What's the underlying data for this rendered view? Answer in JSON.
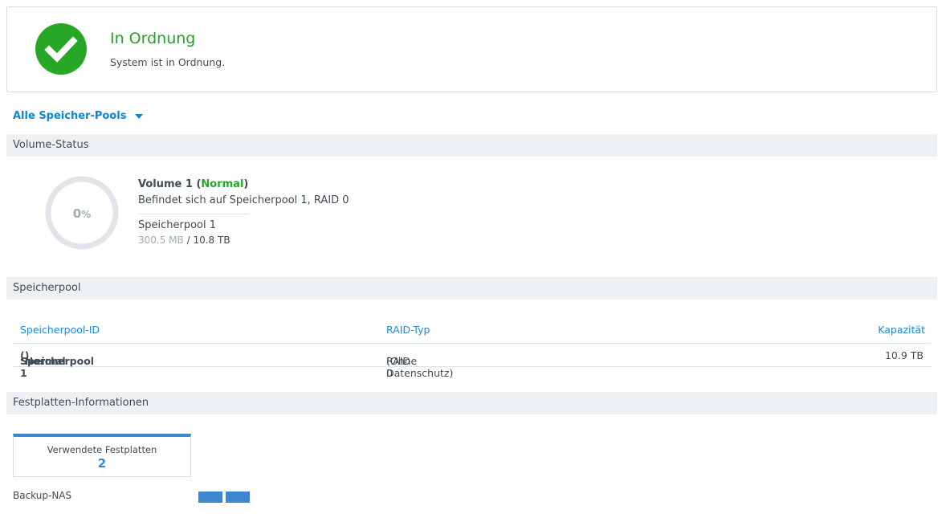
{
  "status": {
    "title": "In Ordnung",
    "subtitle": "System ist in Ordnung.",
    "icon": "check-circle-icon",
    "color": "#26a826"
  },
  "pool_selector": {
    "label": "Alle Speicher-Pools"
  },
  "volume_status": {
    "header": "Volume-Status",
    "usage_value": "0",
    "usage_unit": "%",
    "volume_name": "Volume 1",
    "state": "Normal",
    "location": "Befindet sich auf Speicherpool 1, RAID 0",
    "pool": "Speicherpool 1",
    "used": "300.5 MB",
    "separator": "/",
    "total": "10.8 TB"
  },
  "storage_pool": {
    "header": "Speicherpool",
    "columns": {
      "id": "Speicherpool-ID",
      "raid": "RAID-Typ",
      "capacity": "Kapazität"
    },
    "rows": [
      {
        "name": "Speicherpool 1",
        "state": "Normal",
        "raid": "RAID 0",
        "raid_note": "(Ohne Datenschutz)",
        "capacity": "10.9 TB"
      }
    ]
  },
  "disk_info": {
    "header": "Festplatten-Informationen",
    "card_label": "Verwendete Festplatten",
    "card_count": "2",
    "nas_name": "Backup-NAS",
    "disk_count_bars": 2
  },
  "colors": {
    "accent": "#0f85d2",
    "ok": "#26a826",
    "warning": "#e2463f",
    "disk": "#3d87d1"
  }
}
